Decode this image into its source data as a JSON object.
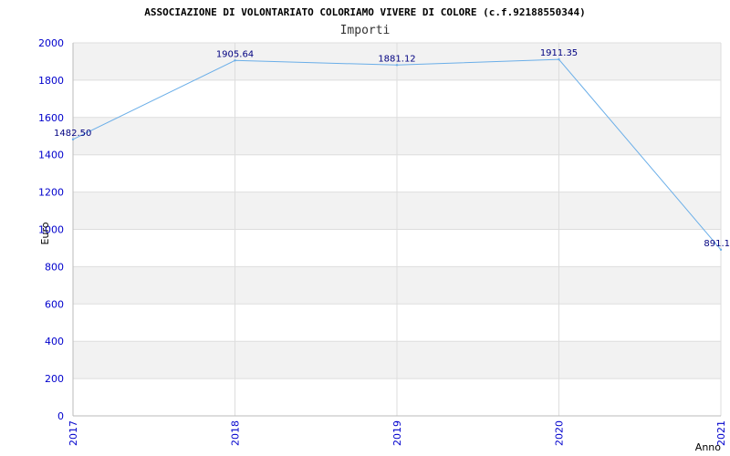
{
  "chart_data": {
    "type": "line",
    "title": "ASSOCIAZIONE DI VOLONTARIATO COLORIAMO VIVERE DI COLORE (c.f.92188550344)",
    "subtitle": "Importi",
    "xlabel": "Anno",
    "ylabel": "Euro",
    "categories": [
      "2017",
      "2018",
      "2019",
      "2020",
      "2021"
    ],
    "series": [
      {
        "values": [
          1482.5,
          1905.64,
          1881.12,
          1911.35,
          891.1
        ],
        "labels": [
          "1482.50",
          "1905.64",
          "1881.12",
          "1911.35",
          "891.1"
        ]
      }
    ],
    "ylim": [
      0,
      2000
    ],
    "yticks": [
      "0",
      "200",
      "400",
      "600",
      "800",
      "1000",
      "1200",
      "1400",
      "1600",
      "1800",
      "2000"
    ],
    "grid": true,
    "colors": {
      "line": "#6aaee8",
      "band": "#f2f2f2",
      "tick_text": "#0000cc",
      "data_label": "#000080"
    }
  }
}
